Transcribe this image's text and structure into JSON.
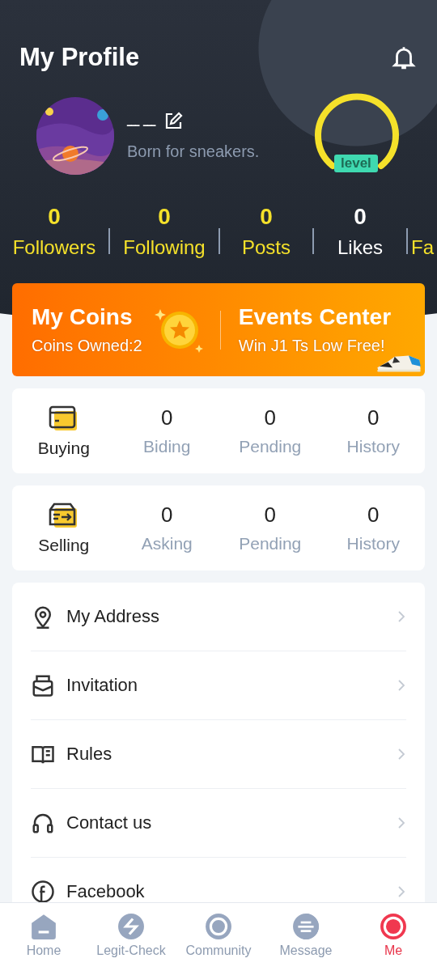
{
  "header": {
    "title": "My Profile"
  },
  "profile": {
    "name": "ـــ ـــ",
    "bio": "Born for sneakers.",
    "level_badge": "level"
  },
  "stats": [
    {
      "value": "0",
      "label": "Followers",
      "color": "#f5e12a"
    },
    {
      "value": "0",
      "label": "Following",
      "color": "#f5e12a"
    },
    {
      "value": "0",
      "label": "Posts",
      "color": "#f5e12a"
    },
    {
      "value": "0",
      "label": "Likes",
      "color": "#ffffff"
    },
    {
      "label": "Fa",
      "color": "#f5e12a"
    }
  ],
  "promo": {
    "coins_title": "My Coins",
    "coins_owned": "Coins Owned:2",
    "events_title": "Events Center",
    "events_subtitle": "Win J1 Ts Low Free!"
  },
  "orders": [
    {
      "title": "Buying",
      "counters": [
        {
          "value": "0",
          "label": "Biding"
        },
        {
          "value": "0",
          "label": "Pending"
        },
        {
          "value": "0",
          "label": "History"
        }
      ]
    },
    {
      "title": "Selling",
      "counters": [
        {
          "value": "0",
          "label": "Asking"
        },
        {
          "value": "0",
          "label": "Pending"
        },
        {
          "value": "0",
          "label": "History"
        }
      ]
    }
  ],
  "menu": [
    {
      "label": "My Address"
    },
    {
      "label": "Invitation"
    },
    {
      "label": "Rules"
    },
    {
      "label": "Contact us"
    },
    {
      "label": "Facebook"
    }
  ],
  "tabs": [
    {
      "label": "Home",
      "selected": false
    },
    {
      "label": "Legit-Check",
      "selected": false
    },
    {
      "label": "Community",
      "selected": false
    },
    {
      "label": "Message",
      "selected": false
    },
    {
      "label": "Me",
      "selected": true
    }
  ]
}
